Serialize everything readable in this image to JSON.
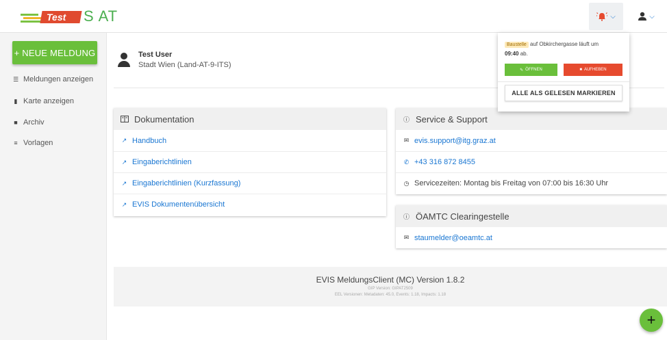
{
  "header": {
    "logo_badge": "Test",
    "logo_text": "S AT",
    "notifications_icon": "alarm-bell-icon",
    "user_icon": "person-icon",
    "chevron_icon": "chevron-down-icon"
  },
  "sidebar": {
    "new_button": "+ NEUE MELDUNG",
    "items": [
      {
        "icon": "list-icon",
        "glyph": "☰",
        "label": "Meldungen anzeigen"
      },
      {
        "icon": "map-icon",
        "glyph": "▮",
        "label": "Karte anzeigen"
      },
      {
        "icon": "archive-icon",
        "glyph": "■",
        "label": "Archiv"
      },
      {
        "icon": "templates-icon",
        "glyph": "≡",
        "label": "Vorlagen"
      }
    ]
  },
  "user": {
    "name": "Test User",
    "org": "Stadt Wien (Land-AT-9-ITS)"
  },
  "documentation": {
    "title": "Dokumentation",
    "links": [
      "Handbuch",
      "Eingaberichtlinien",
      "Eingaberichtlinien (Kurzfassung)",
      "EVIS Dokumentenübersicht"
    ]
  },
  "support": {
    "title": "Service & Support",
    "email": "evis.support@itg.graz.at",
    "phone": "+43 316 872 8455",
    "hours": "Servicezeiten: Montag bis Freitag von 07:00 bis 16:30 Uhr"
  },
  "oeamtc": {
    "title": "ÖAMTC Clearingestelle",
    "email": "staumelder@oeamtc.at"
  },
  "footer": {
    "title": "EVIS MeldungsClient (MC) Version 1.8.2",
    "gip": "GIP Version: GIPAT2509",
    "eel": "EEL Versionen: Metadaten: 45.0, Events: 1.18, Impacts: 1.18"
  },
  "notification": {
    "badge": "Baustelle",
    "text": "auf Obkirchergasse läuft um",
    "time": "09:40",
    "suffix": "ab.",
    "open_button": "ÖFFNEN",
    "cancel_button": "AUFHEBEN",
    "mark_all": "ALLE ALS GELESEN MARKIEREN"
  },
  "fab_label": "+",
  "colors": {
    "accent_green": "#6abf3b",
    "danger_red": "#e64a2e",
    "link_blue": "#1976d2"
  }
}
